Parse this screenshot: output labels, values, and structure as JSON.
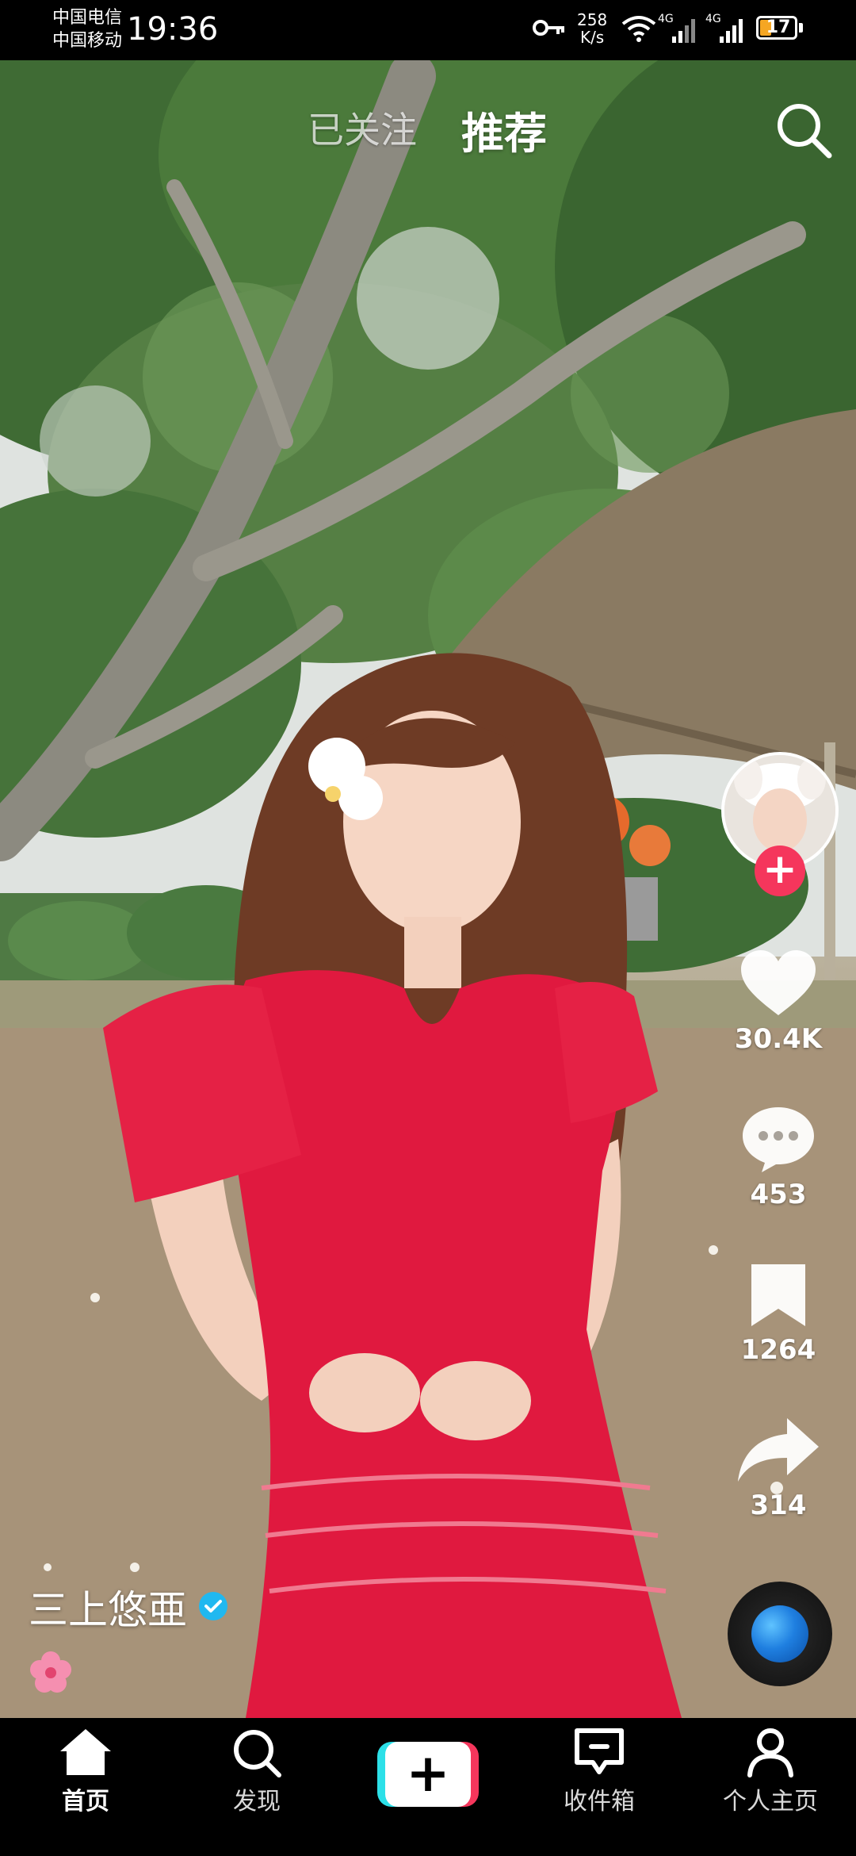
{
  "status_bar": {
    "carrier_1": "中国电信",
    "carrier_2": "中国移动",
    "time": "19:36",
    "net_speed_value": "258",
    "net_speed_unit": "K/s",
    "signal_1_label": "4G",
    "signal_2_label": "4G",
    "battery": "17"
  },
  "top_tabs": {
    "following": "已关注",
    "recommended": "推荐",
    "active": "recommended"
  },
  "actions": {
    "likes": "30.4K",
    "comments": "453",
    "favorites": "1264",
    "shares": "314"
  },
  "video": {
    "author": "三上悠亜",
    "verified": true,
    "caption_emoji": "🌸"
  },
  "bottom_nav": {
    "home": "首页",
    "discover": "发现",
    "create_symbol": "+",
    "inbox": "收件箱",
    "profile": "个人主页",
    "active": "home"
  },
  "colors": {
    "accent_red": "#f5365c",
    "accent_cyan": "#2ce0e8",
    "verified_blue": "#20b8f0"
  }
}
